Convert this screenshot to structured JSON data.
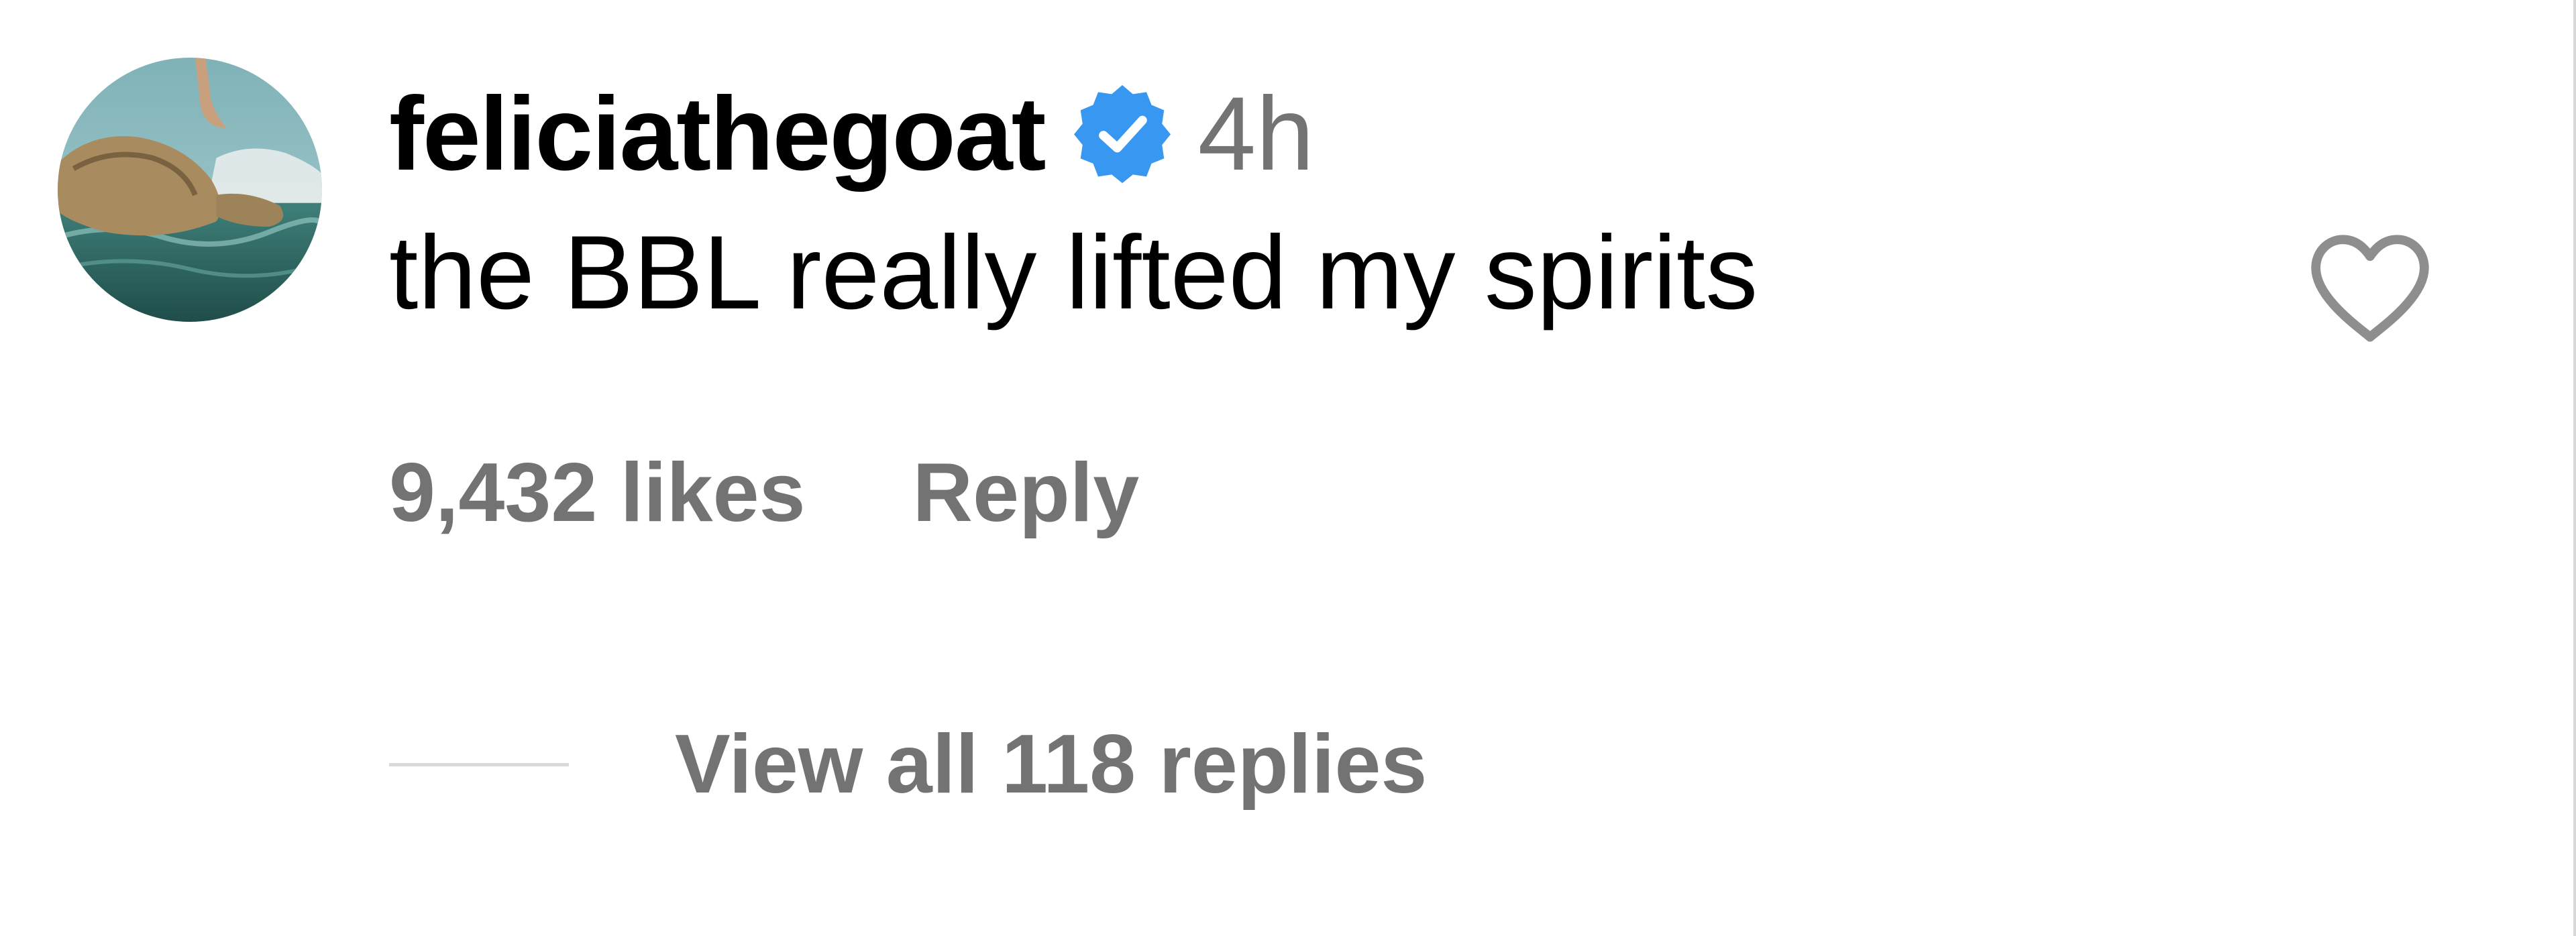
{
  "comment": {
    "avatar_icon": "profile-photo-beach",
    "username": "feliciathegoat",
    "verified_icon": "verified-badge-icon",
    "verified_color": "#3897f0",
    "timestamp": "4h",
    "text": "the BBL really lifted my spirits",
    "like_icon": "heart-outline-icon",
    "likes_label": "9,432 likes",
    "reply_label": "Reply",
    "view_replies_label": "View all 118 replies"
  },
  "colors": {
    "primary_text": "#000000",
    "secondary_text": "#737373",
    "divider": "#d9d9d9",
    "background": "#ffffff"
  }
}
